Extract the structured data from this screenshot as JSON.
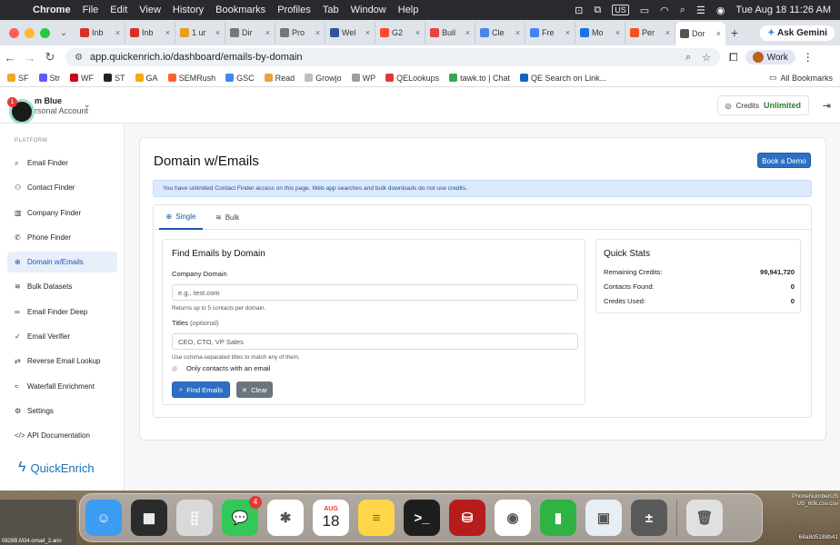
{
  "menubar": {
    "app": "Chrome",
    "items": [
      "File",
      "Edit",
      "View",
      "History",
      "Bookmarks",
      "Profiles",
      "Tab",
      "Window",
      "Help"
    ],
    "input_source": "US",
    "datetime": "Tue Aug 18  11:26 AM"
  },
  "browser": {
    "tabs": [
      {
        "label": "Inb",
        "icon": "gmail-icon",
        "color": "#d93025"
      },
      {
        "label": "Inb",
        "icon": "gmail-icon",
        "color": "#d93025"
      },
      {
        "label": "1 ur",
        "icon": "flag-icon",
        "color": "#e6a117"
      },
      {
        "label": "Dir",
        "icon": "globe-icon",
        "color": "#777777"
      },
      {
        "label": "Pro",
        "icon": "globe-icon",
        "color": "#777777"
      },
      {
        "label": "Wel",
        "icon": "word-icon",
        "color": "#2b579a"
      },
      {
        "label": "G2",
        "icon": "g2-icon",
        "color": "#ff492c"
      },
      {
        "label": "Buil",
        "icon": "star-icon",
        "color": "#e8453c"
      },
      {
        "label": "Cle",
        "icon": "doc-icon",
        "color": "#4a86e8"
      },
      {
        "label": "Fre",
        "icon": "circle-icon",
        "color": "#4285f4"
      },
      {
        "label": "Mo",
        "icon": "s-icon",
        "color": "#1a73e8"
      },
      {
        "label": "Per",
        "icon": "chart-icon",
        "color": "#f4511e"
      },
      {
        "label": "Dor",
        "icon": "globe-icon",
        "color": "#555555",
        "active": true
      }
    ],
    "ask_gemini": "Ask Gemini",
    "url": "app.quickenrich.io/dashboard/emails-by-domain",
    "profile": "Work",
    "bookmarks": [
      {
        "label": "SF",
        "color": "#f5a623"
      },
      {
        "label": "Str",
        "color": "#635bff"
      },
      {
        "label": "WF",
        "color": "#d0021b"
      },
      {
        "label": "ST",
        "color": "#222222"
      },
      {
        "label": "GA",
        "color": "#f9ab00"
      },
      {
        "label": "SEMRush",
        "color": "#ff642d"
      },
      {
        "label": "GSC",
        "color": "#4285f4"
      },
      {
        "label": "Read",
        "color": "#e8a33d"
      },
      {
        "label": "Growjo",
        "color": "#bdbdbd"
      },
      {
        "label": "WP",
        "color": "#9e9e9e"
      },
      {
        "label": "QELookups",
        "color": "#e53935"
      },
      {
        "label": "tawk.to | Chat",
        "color": "#34a853"
      },
      {
        "label": "QE Search on Link...",
        "color": "#0a66c2"
      }
    ],
    "all_bookmarks": "All Bookmarks"
  },
  "app": {
    "account_name": "m Blue",
    "account_type": "rsonal Account",
    "chat_badge": "1",
    "credits_label": "Credits",
    "credits_value": "Unlimited",
    "platform_label": "PLATFORM",
    "nav": [
      {
        "label": "Email Finder",
        "icon": "search-icon"
      },
      {
        "label": "Contact Finder",
        "icon": "users-icon"
      },
      {
        "label": "Company Finder",
        "icon": "building-icon"
      },
      {
        "label": "Phone Finder",
        "icon": "phone-icon"
      },
      {
        "label": "Domain w/Emails",
        "icon": "globe-icon",
        "active": true
      },
      {
        "label": "Bulk Datasets",
        "icon": "database-icon"
      },
      {
        "label": "Email Finder Deep",
        "icon": "binoculars-icon"
      },
      {
        "label": "Email Verifier",
        "icon": "check-icon"
      },
      {
        "label": "Reverse Email Lookup",
        "icon": "retweet-icon"
      },
      {
        "label": "Waterfall Enrichment",
        "icon": "waterfall-icon"
      },
      {
        "label": "Settings",
        "icon": "gear-icon"
      },
      {
        "label": "API Documentation",
        "icon": "code-icon"
      }
    ],
    "brand": "QuickEnrich",
    "page_title": "Domain w/Emails",
    "book_demo": "Book a Demo",
    "alert": "You have unlimited Contact Finder access on this page. Web app searches and bulk downloads do not use credits.",
    "tabs": {
      "single": "Single",
      "bulk": "Bulk"
    },
    "form": {
      "title": "Find Emails by Domain",
      "domain_label": "Company Domain",
      "domain_placeholder": "e.g., test.com",
      "domain_help": "Returns up to 5 contacts per domain.",
      "titles_label": "Titles",
      "titles_optional": "(optional)",
      "titles_placeholder": "CEO, CTO, VP Sales",
      "titles_help": "Use comma-separated titles to match any of them.",
      "only_with_email": "Only contacts with an email",
      "find_button": "Find Emails",
      "clear_button": "Clear"
    },
    "stats": {
      "title": "Quick Stats",
      "rows": [
        {
          "label": "Remaining Credits:",
          "value": "99,941,720"
        },
        {
          "label": "Contacts Found:",
          "value": "0"
        },
        {
          "label": "Credits Used:",
          "value": "0"
        }
      ]
    }
  },
  "dock": {
    "apps": [
      {
        "name": "finder-icon",
        "color": "#3b9cf2"
      },
      {
        "name": "mission-control-icon",
        "color": "#2b2b2b"
      },
      {
        "name": "launchpad-icon",
        "color": "#d9d9d9"
      },
      {
        "name": "messages-icon",
        "color": "#34c759",
        "badge": "4"
      },
      {
        "name": "slack-icon",
        "color": "#ffffff"
      },
      {
        "name": "calendar-icon",
        "color": "#ffffff",
        "month": "AUG",
        "day": "18"
      },
      {
        "name": "notes-icon",
        "color": "#ffd54a"
      },
      {
        "name": "terminal-icon",
        "color": "#1e1e1e"
      },
      {
        "name": "database-app-icon",
        "color": "#b71c1c"
      },
      {
        "name": "chrome-icon",
        "color": "#ffffff"
      },
      {
        "name": "numbers-icon",
        "color": "#2fb344"
      },
      {
        "name": "preview-icon",
        "color": "#e8eef5"
      },
      {
        "name": "calculator-icon",
        "color": "#5a5a5a"
      },
      {
        "name": "trash-icon",
        "color": "#e0e0e0"
      }
    ],
    "desktop_left_caption": "0828B.M34.omad_2.ann",
    "desktop_right_captions": [
      "PhoneNumberUS",
      "US_60k.csv.csv",
      "68a8d5188b41"
    ]
  }
}
